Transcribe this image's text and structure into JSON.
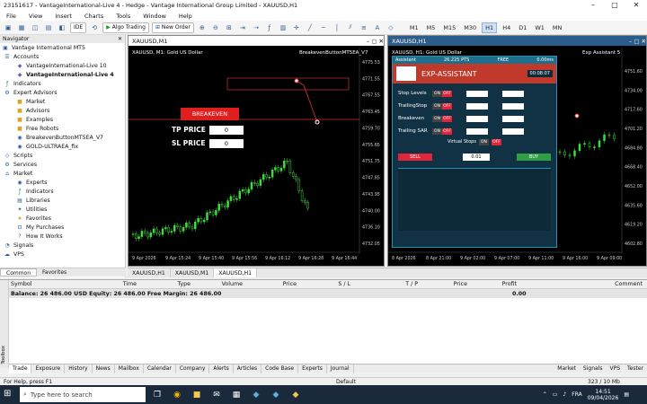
{
  "window": {
    "title": "23151617 - VantageInternational-Live 4 - Hedge - Vantage International Group Limited - XAUUSD,H1"
  },
  "menu": [
    "File",
    "View",
    "Insert",
    "Charts",
    "Tools",
    "Window",
    "Help"
  ],
  "toolbar": {
    "algo_trading": "Algo Trading",
    "new_order": "New Order",
    "ide": "IDE",
    "timeframes": [
      "M1",
      "M5",
      "M15",
      "M30",
      "H1",
      "H4",
      "D1",
      "W1",
      "MN"
    ]
  },
  "navigator": {
    "title": "Navigator",
    "root": "Vantage International MT5",
    "accounts": "Accounts",
    "account1": "VantageInternational-Live 10",
    "account2": "VantageInternational-Live 4",
    "indicators": "Indicators",
    "expert_advisors": "Expert Advisors",
    "market": "Market",
    "advisors": "Advisors",
    "examples": "Examples",
    "free_robots": "Free Robots",
    "ea1": "BreakevenButtonMT5EA_V7",
    "ea2": "GOLD-ULTRAEA_fix",
    "scripts": "Scripts",
    "services": "Services",
    "market2": "Market",
    "experts": "Experts",
    "indicators2": "Indicators",
    "libraries": "Libraries",
    "utilities": "Utilities",
    "favorites": "Favorites",
    "purchases": "My Purchases",
    "howitworks": "How It Works",
    "signals": "Signals",
    "vps": "VPS",
    "tabs": [
      "Common",
      "Favorites"
    ]
  },
  "chart1": {
    "tab": "XAUUSD,M1",
    "label": "XAUUSD, M1: Gold US Dollar",
    "ea": "BreakevenButtonMT5EA_V7",
    "breakeven": "BREAKEVEN",
    "tp_label": "TP PRICE",
    "tp_value": "0",
    "sl_label": "SL PRICE",
    "sl_value": "0",
    "prices": [
      "4775.53",
      "4771.55",
      "4767.55",
      "4763.45",
      "4759.70",
      "4755.65",
      "4751.75",
      "4747.85",
      "4743.95",
      "4740.00",
      "4736.10",
      "4732.05"
    ],
    "times": [
      "9 Apr 2026",
      "9 Apr 15:24",
      "9 Apr 15:40",
      "9 Apr 15:56",
      "9 Apr 16:12",
      "9 Apr 16:28",
      "9 Apr 16:44"
    ]
  },
  "chart2": {
    "tab": "XAUUSD,H1",
    "label": "XAUUSD, H1: Gold US Dollar",
    "ea": "Exp Assistant 5",
    "prices": [
      "4751.60",
      "4734.00",
      "4717.60",
      "4701.20",
      "4684.80",
      "4668.40",
      "4652.00",
      "4635.60",
      "4619.20",
      "4602.80"
    ],
    "times": [
      "8 Apr 2026",
      "8 Apr 21:00",
      "9 Apr 02:00",
      "9 Apr 07:00",
      "9 Apr 11:00",
      "9 Apr 16:00",
      "9 Apr 09:00"
    ],
    "ea_panel": {
      "assistant": "Assistant",
      "spread": "26.225 PTS",
      "free": "FREE",
      "lots": "0.00ms",
      "title": "EXP-ASSISTANT",
      "timer": "00:08:07",
      "rows": [
        "Stop Levels",
        "TrailingStop",
        "Breakeven",
        "Trailing SAR"
      ],
      "virtual_stops": "Virtual Stops",
      "sell": "SELL",
      "buy": "BUY",
      "lot": "0.01",
      "on": "ON",
      "off": "OFF"
    }
  },
  "chart_tabs": [
    "XAUUSD,H1",
    "XAUUSD,M1",
    "XAUUSD,H1"
  ],
  "terminal": {
    "columns": [
      "Symbol",
      "Time",
      "Type",
      "Volume",
      "Price",
      "S / L",
      "T / P",
      "Price",
      "Profit",
      "Comment"
    ],
    "balance": "Balance: 26 486.00 USD  Equity: 26 486.00  Free Margin: 26 486.00",
    "profit": "0.00",
    "tabs": [
      "Trade",
      "Exposure",
      "History",
      "News",
      "Mailbox",
      "Calendar",
      "Company",
      "Alerts",
      "Articles",
      "Code Base",
      "Experts",
      "Journal"
    ],
    "right": [
      "Market",
      "Signals",
      "VPS",
      "Tester"
    ],
    "side": "Toolbox"
  },
  "status": {
    "help": "For Help, press F1",
    "profile": "Default",
    "net": "323 / 10 Mb"
  },
  "taskbar": {
    "search": "Type here to search",
    "lang": "FRA",
    "time": "14:51",
    "date": "09/04/2026"
  }
}
